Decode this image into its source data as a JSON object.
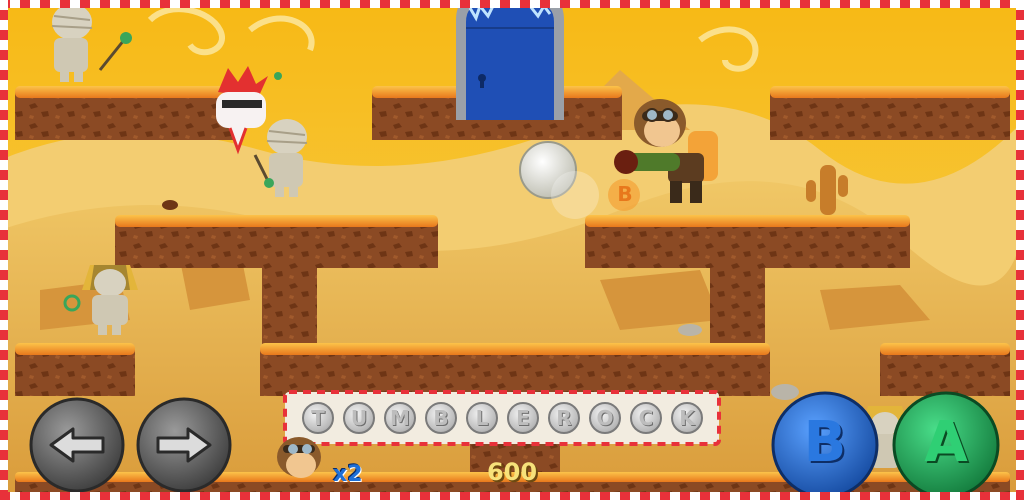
{
  "controls": {
    "left_icon": "arrow-left-icon",
    "right_icon": "arrow-right-icon",
    "b_label": "B",
    "a_label": "A"
  },
  "word_bar": {
    "letters": [
      "T",
      "U",
      "M",
      "B",
      "L",
      "E",
      "R",
      "O",
      "C",
      "K"
    ]
  },
  "hud": {
    "lives": "x2",
    "score": "600"
  },
  "pickup_label": "B",
  "colors": {
    "sky": "#f7c21b",
    "dune": "#e9b343",
    "dirt": "#8b4a24",
    "grass": "#f2931c",
    "door": "#1f4fb5",
    "b_button": "#1f64c9",
    "a_button": "#1e9d52",
    "lives_text": "#1e6fd6",
    "score_text": "#f7e27a",
    "border_red": "#e8313a"
  }
}
